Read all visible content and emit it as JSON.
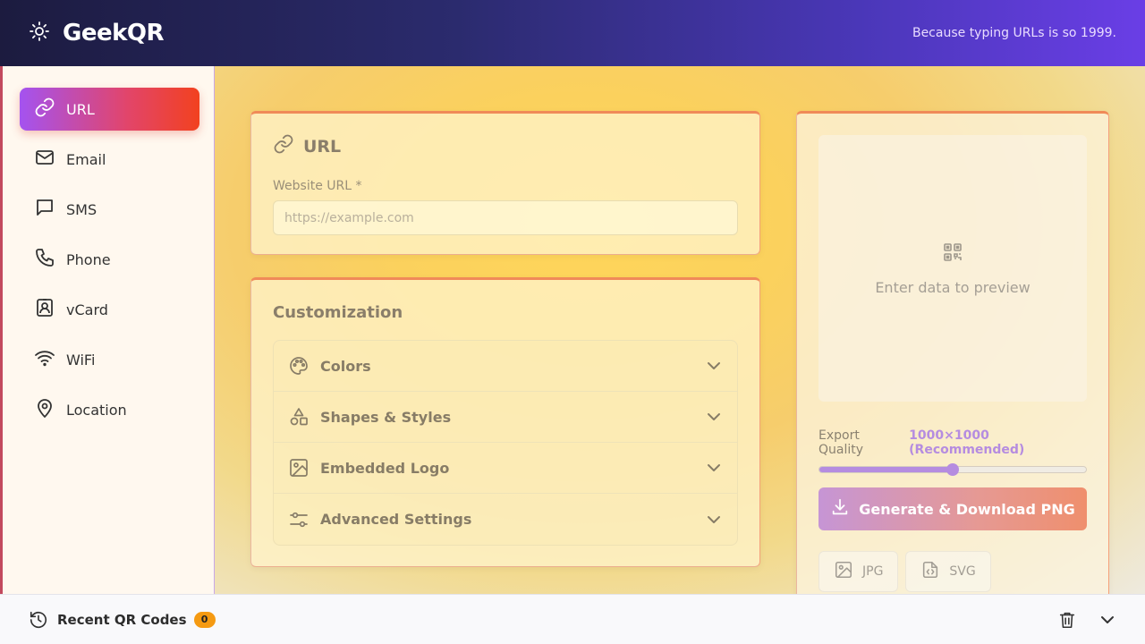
{
  "header": {
    "brand": "GeekQR",
    "tagline": "Because typing URLs is so 1999."
  },
  "sidebar": {
    "items": [
      {
        "label": "URL",
        "icon": "link-icon",
        "active": true
      },
      {
        "label": "Email",
        "icon": "mail-icon"
      },
      {
        "label": "SMS",
        "icon": "message-icon"
      },
      {
        "label": "Phone",
        "icon": "phone-icon"
      },
      {
        "label": "vCard",
        "icon": "contact-card-icon"
      },
      {
        "label": "WiFi",
        "icon": "wifi-icon"
      },
      {
        "label": "Location",
        "icon": "map-pin-icon"
      }
    ]
  },
  "url_card": {
    "title": "URL",
    "field_label": "Website URL *",
    "placeholder": "https://example.com",
    "value": ""
  },
  "customization": {
    "title": "Customization",
    "sections": [
      {
        "label": "Colors",
        "icon": "palette-icon"
      },
      {
        "label": "Shapes & Styles",
        "icon": "shapes-icon"
      },
      {
        "label": "Embedded Logo",
        "icon": "image-icon"
      },
      {
        "label": "Advanced Settings",
        "icon": "sliders-icon"
      }
    ]
  },
  "preview": {
    "empty_text": "Enter data to preview",
    "export_quality_label": "Export Quality",
    "export_quality_value": "1000×1000 (Recommended)",
    "slider_fraction": 0.5,
    "download_button": "Generate & Download PNG",
    "formats": [
      "JPG",
      "SVG"
    ]
  },
  "footer": {
    "recent_label": "Recent QR Codes",
    "count": "0"
  },
  "colors": {
    "accent_purple": "#b58ce0",
    "active_gradient_start": "#a453f0",
    "active_gradient_end": "#f2411f",
    "badge": "#f59a12"
  }
}
